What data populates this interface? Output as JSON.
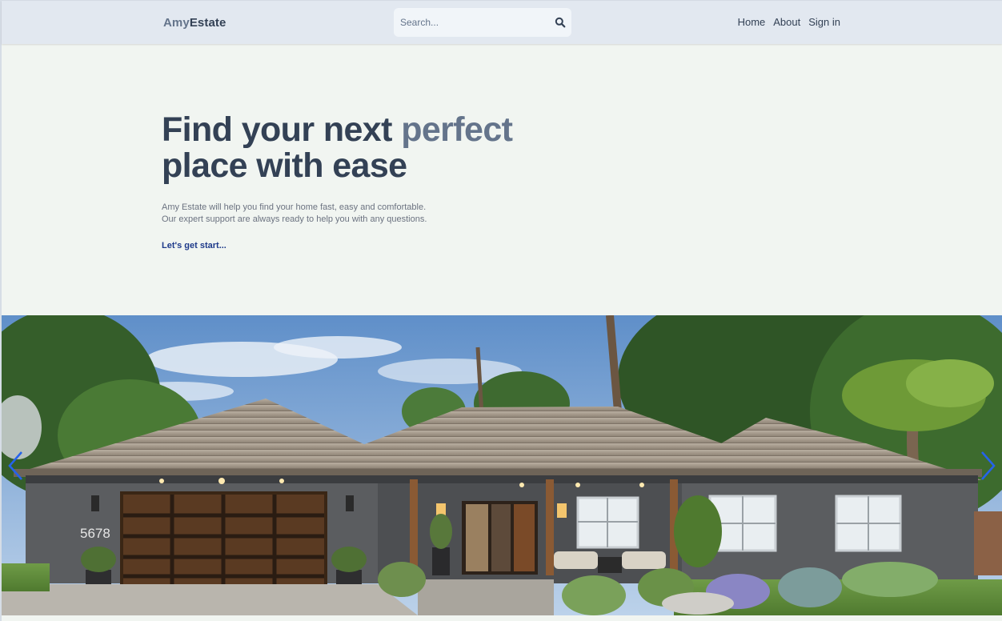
{
  "header": {
    "brand_part1": "Amy",
    "brand_part2": "Estate",
    "search": {
      "placeholder": "Search..."
    },
    "nav": [
      {
        "label": "Home"
      },
      {
        "label": "About"
      },
      {
        "label": "Sign in"
      }
    ]
  },
  "hero": {
    "title_line1_a": "Find your next ",
    "title_line1_accent": "perfect",
    "title_line2": "place with ease",
    "desc_line1": "Amy Estate will help you find your home fast, easy and comfortable.",
    "desc_line2": "Our expert support are always ready to help you with any questions.",
    "cta_label": "Let's get start..."
  },
  "slider": {
    "house_number": "5678",
    "prev_icon": "chevron-left-icon",
    "next_icon": "chevron-right-icon"
  },
  "colors": {
    "header_bg": "#e2e8f0",
    "page_bg": "#f1f5f1",
    "heading": "#334155",
    "accent": "#64748b",
    "cta": "#1e3a8a",
    "arrow": "#2563eb"
  }
}
